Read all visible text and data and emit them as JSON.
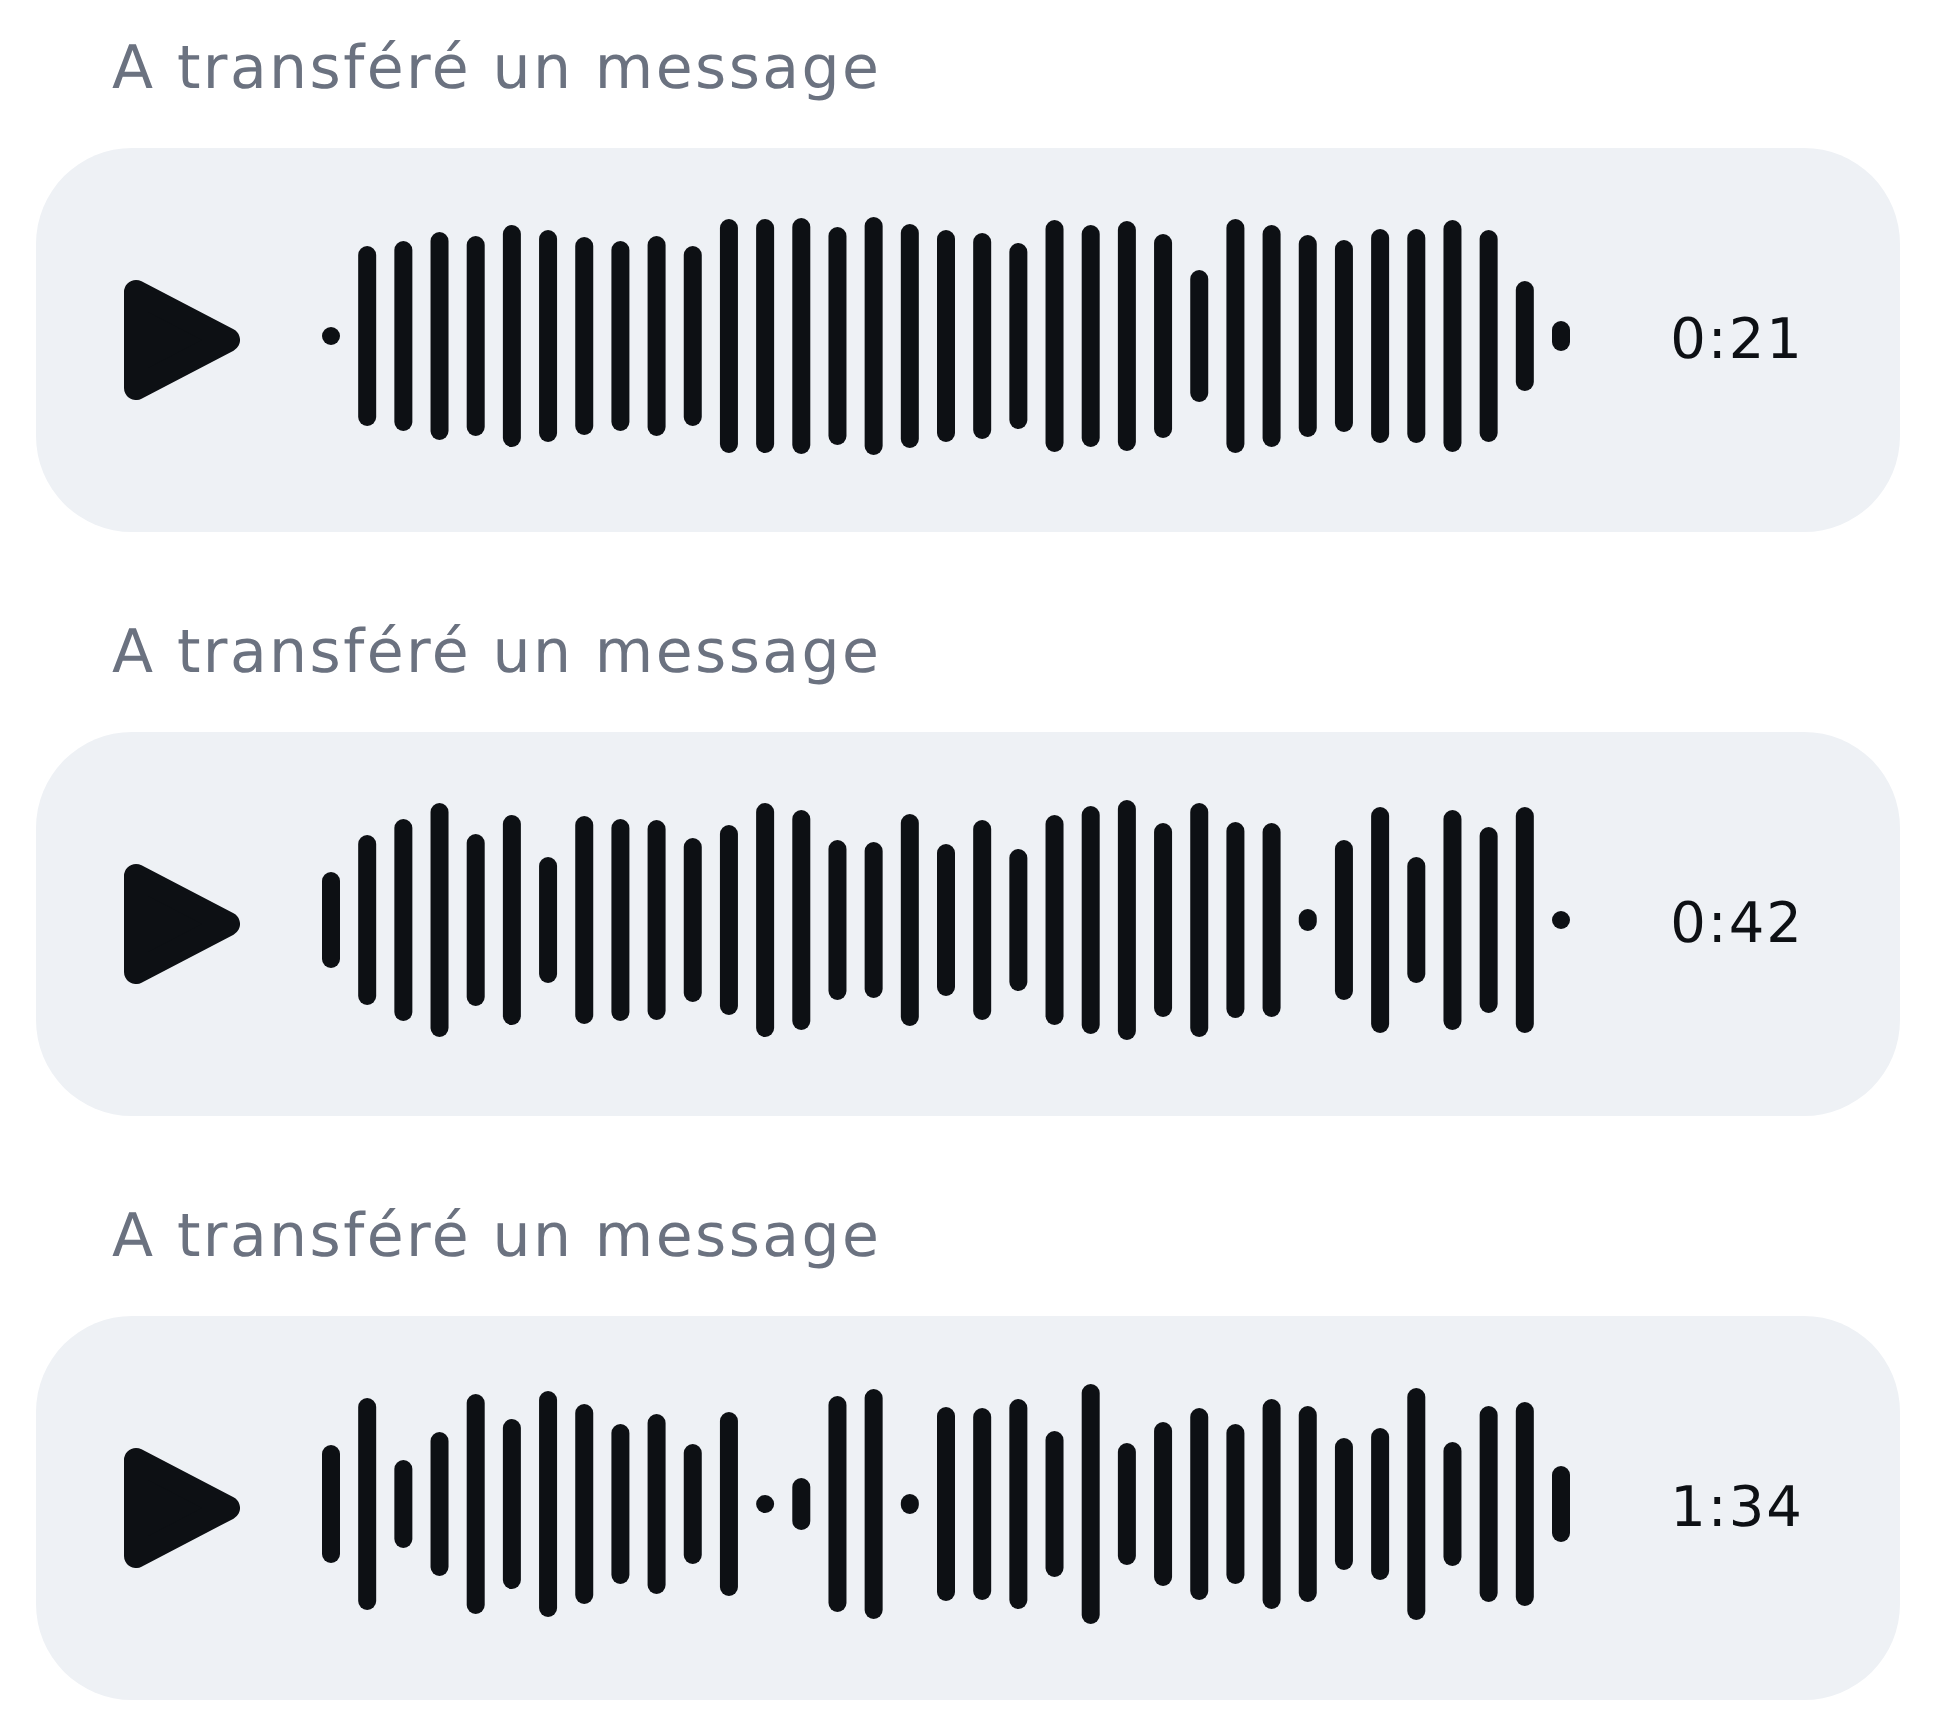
{
  "messages": [
    {
      "label": "A transféré un message",
      "duration": "0:21"
    },
    {
      "label": "A transféré un message",
      "duration": "0:42"
    },
    {
      "label": "A transféré un message",
      "duration": "1:34"
    }
  ]
}
